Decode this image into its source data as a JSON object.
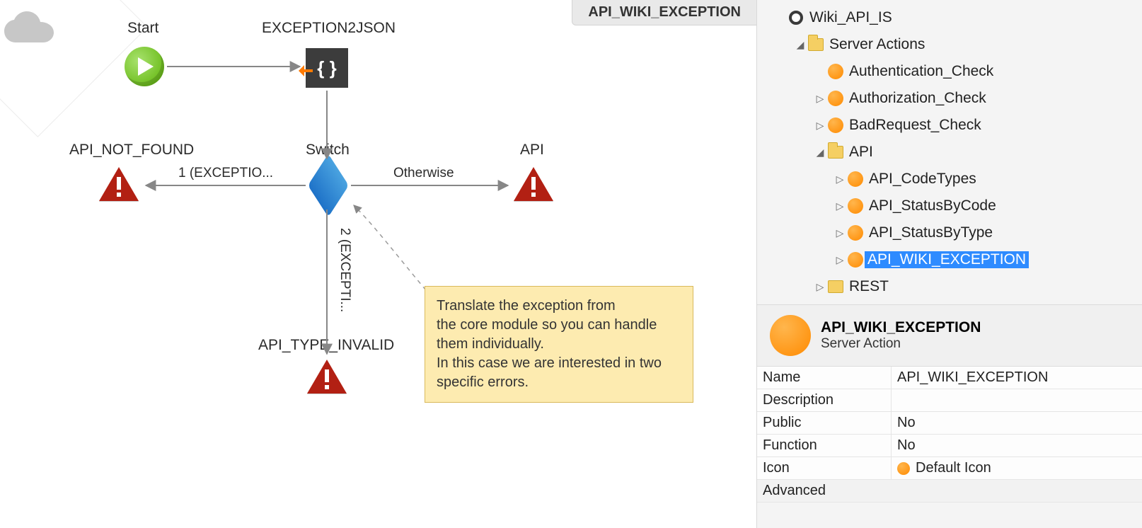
{
  "breadcrumb": "API_WIKI_EXCEPTION",
  "diagram": {
    "start_label": "Start",
    "json_label": "EXCEPTION2JSON",
    "switch_label": "Switch",
    "api_label": "API",
    "not_found_label": "API_NOT_FOUND",
    "type_invalid_label": "API_TYPE_INVALID",
    "edge_left": "1 (EXCEPTIO...",
    "edge_right": "Otherwise",
    "edge_down": "2 (EXCEPTI...",
    "note_l1": "Translate the exception from",
    "note_l2": "the core module so you can handle",
    "note_l3": "them individually.",
    "note_l4": "In this case we are interested in two",
    "note_l5": "specific errors."
  },
  "tree": {
    "module": "Wiki_API_IS",
    "server_actions": "Server Actions",
    "items": {
      "auth_check": "Authentication_Check",
      "authz_check": "Authorization_Check",
      "badreq": "BadRequest_Check",
      "api_folder": "API",
      "api_codetypes": "API_CodeTypes",
      "api_statusbycode": "API_StatusByCode",
      "api_statusbytype": "API_StatusByType",
      "api_wiki_exception": "API_WIKI_EXCEPTION",
      "rest": "REST"
    }
  },
  "props": {
    "title": "API_WIKI_EXCEPTION",
    "subtitle": "Server Action",
    "rows": {
      "name_k": "Name",
      "name_v": "API_WIKI_EXCEPTION",
      "desc_k": "Description",
      "desc_v": "",
      "public_k": "Public",
      "public_v": "No",
      "function_k": "Function",
      "function_v": "No",
      "icon_k": "Icon",
      "icon_v": "Default Icon",
      "advanced": "Advanced"
    }
  }
}
